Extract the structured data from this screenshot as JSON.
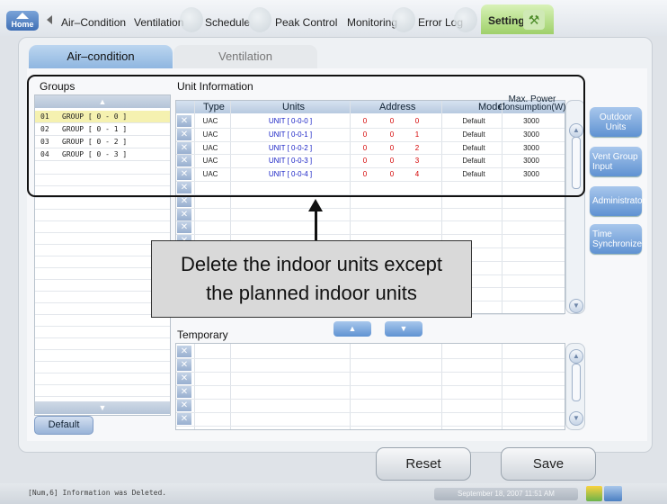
{
  "top_tabs": {
    "home": "Home",
    "items": [
      "Air–Condition",
      "Ventilation",
      "Schedule",
      "Peak Control",
      "Monitoring",
      "Error Log"
    ],
    "active": "Setting"
  },
  "sub_tabs": {
    "air": "Air–condition",
    "vent": "Ventilation"
  },
  "groups": {
    "header": "Groups",
    "items": [
      {
        "no": "01",
        "name": "GROUP [ 0 - 0 ]",
        "selected": true
      },
      {
        "no": "02",
        "name": "GROUP [ 0 - 1 ]",
        "selected": false
      },
      {
        "no": "03",
        "name": "GROUP [ 0 - 2 ]",
        "selected": false
      },
      {
        "no": "04",
        "name": "GROUP [ 0 - 3 ]",
        "selected": false
      }
    ],
    "default_button": "Default"
  },
  "unit_info": {
    "header": "Unit Information",
    "columns": {
      "type": "Type",
      "units": "Units",
      "address": "Address",
      "model": "Model",
      "power": "Max. Power Consumption(W)"
    },
    "rows": [
      {
        "type": "UAC",
        "unit": "UNIT [ 0-0-0 ]",
        "a1": "0",
        "a2": "0",
        "a3": "0",
        "model": "Default",
        "power": "3000"
      },
      {
        "type": "UAC",
        "unit": "UNIT [ 0-0-1 ]",
        "a1": "0",
        "a2": "0",
        "a3": "1",
        "model": "Default",
        "power": "3000"
      },
      {
        "type": "UAC",
        "unit": "UNIT [ 0-0-2 ]",
        "a1": "0",
        "a2": "0",
        "a3": "2",
        "model": "Default",
        "power": "3000"
      },
      {
        "type": "UAC",
        "unit": "UNIT [ 0-0-3 ]",
        "a1": "0",
        "a2": "0",
        "a3": "3",
        "model": "Default",
        "power": "3000"
      },
      {
        "type": "UAC",
        "unit": "UNIT [ 0-0-4 ]",
        "a1": "0",
        "a2": "0",
        "a3": "4",
        "model": "Default",
        "power": "3000"
      }
    ]
  },
  "temporary": {
    "header": "Temporary"
  },
  "side_buttons": {
    "outdoor": "Outdoor Units",
    "vent_group": "Vent Group Input",
    "admin": "Administrator",
    "time_sync": "Time Synchronize"
  },
  "actions": {
    "reset": "Reset",
    "save": "Save"
  },
  "annotation": {
    "line1": "Delete the indoor units except",
    "line2": "the planned indoor units"
  },
  "status": {
    "message": "[Num,6] Information was Deleted.",
    "datetime": "September 18, 2007 11:51 AM"
  },
  "colors": {
    "accent_green": "#9fd06a",
    "button_blue": "#5f92d2",
    "address_red": "#d40000",
    "unit_blue": "#1a23c6"
  }
}
